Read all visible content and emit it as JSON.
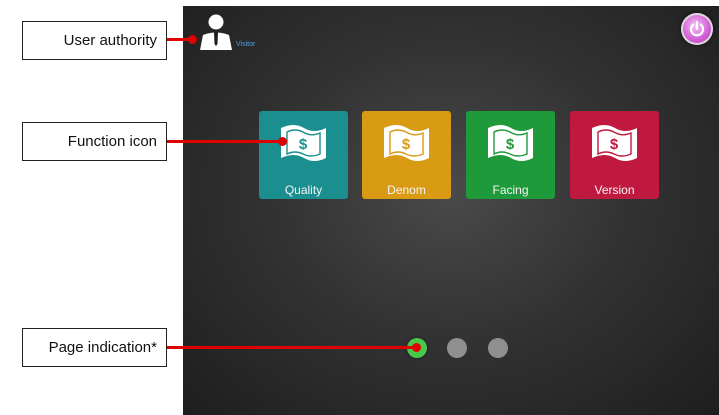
{
  "screen": {
    "user_role": "Visitor",
    "power_icon": "power-icon",
    "tiles": [
      {
        "label": "Quality",
        "color": "#1b8f8f"
      },
      {
        "label": "Denom",
        "color": "#d99a14"
      },
      {
        "label": "Facing",
        "color": "#1f9a3a"
      },
      {
        "label": "Version",
        "color": "#c0193f"
      }
    ],
    "tile_icon": "banknote-icon",
    "pagination": {
      "pages": 3,
      "current": 1
    }
  },
  "callouts": {
    "user_authority": "User authority",
    "function_icon": "Function icon",
    "page_indication": "Page indication*"
  },
  "colors": {
    "leader_line": "#e00000",
    "active_page": "#47c84a",
    "inactive_page": "#8f8f8f"
  }
}
